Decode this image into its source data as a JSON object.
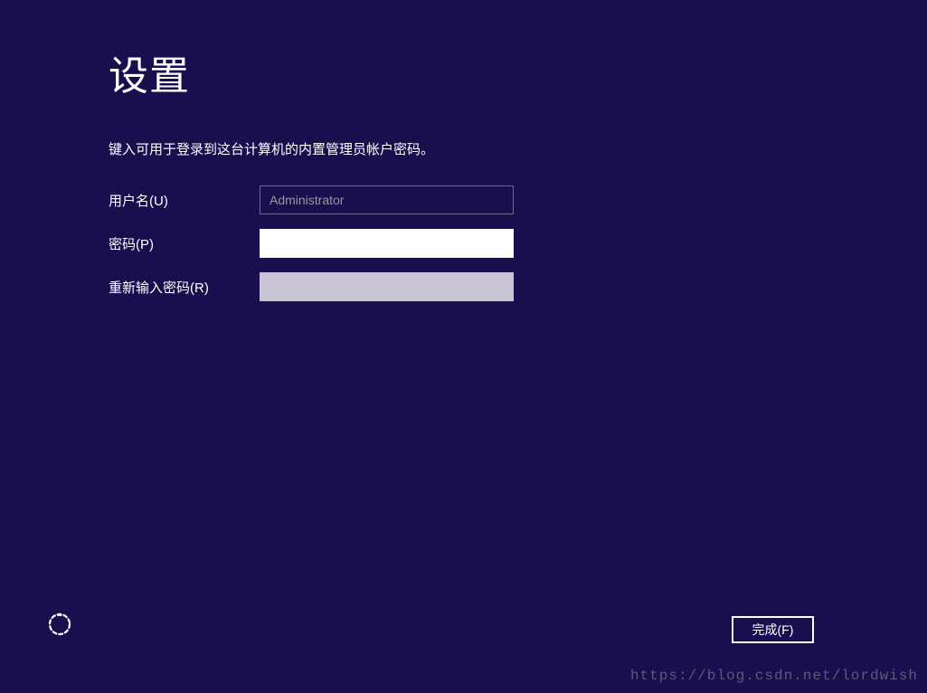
{
  "page": {
    "title": "设置",
    "description": "键入可用于登录到这台计算机的内置管理员帐户密码。"
  },
  "form": {
    "username": {
      "label": "用户名(U)",
      "value": "Administrator"
    },
    "password": {
      "label": "密码(P)",
      "value": ""
    },
    "confirmPassword": {
      "label": "重新输入密码(R)",
      "value": ""
    }
  },
  "buttons": {
    "finish": "完成(F)"
  },
  "watermark": "https://blog.csdn.net/lordwish"
}
